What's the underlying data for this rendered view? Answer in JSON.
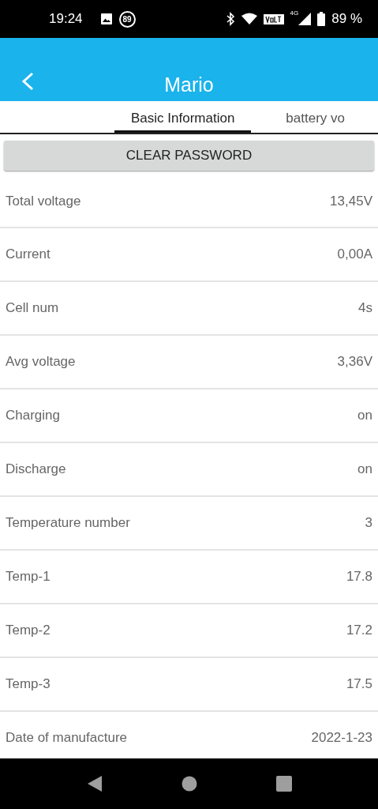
{
  "status_bar": {
    "time": "19:24",
    "notification_count": "89",
    "network": "4G",
    "battery": "89 %"
  },
  "header": {
    "title": "Mario"
  },
  "tabs": [
    {
      "label": "Basic Information",
      "selected": true
    },
    {
      "label": "battery vo",
      "selected": false
    }
  ],
  "clear_button": "CLEAR PASSWORD",
  "rows": [
    {
      "label": "Total voltage",
      "value": "13,45V"
    },
    {
      "label": "Current",
      "value": "0,00A"
    },
    {
      "label": "Cell num",
      "value": "4s"
    },
    {
      "label": "Avg voltage",
      "value": "3,36V"
    },
    {
      "label": "Charging",
      "value": "on"
    },
    {
      "label": "Discharge",
      "value": "on"
    },
    {
      "label": "Temperature number",
      "value": "3"
    },
    {
      "label": "Temp-1",
      "value": "17.8"
    },
    {
      "label": "Temp-2",
      "value": "17.2"
    },
    {
      "label": "Temp-3",
      "value": "17.5"
    },
    {
      "label": "Date of manufacture",
      "value": "2022-1-23"
    }
  ]
}
